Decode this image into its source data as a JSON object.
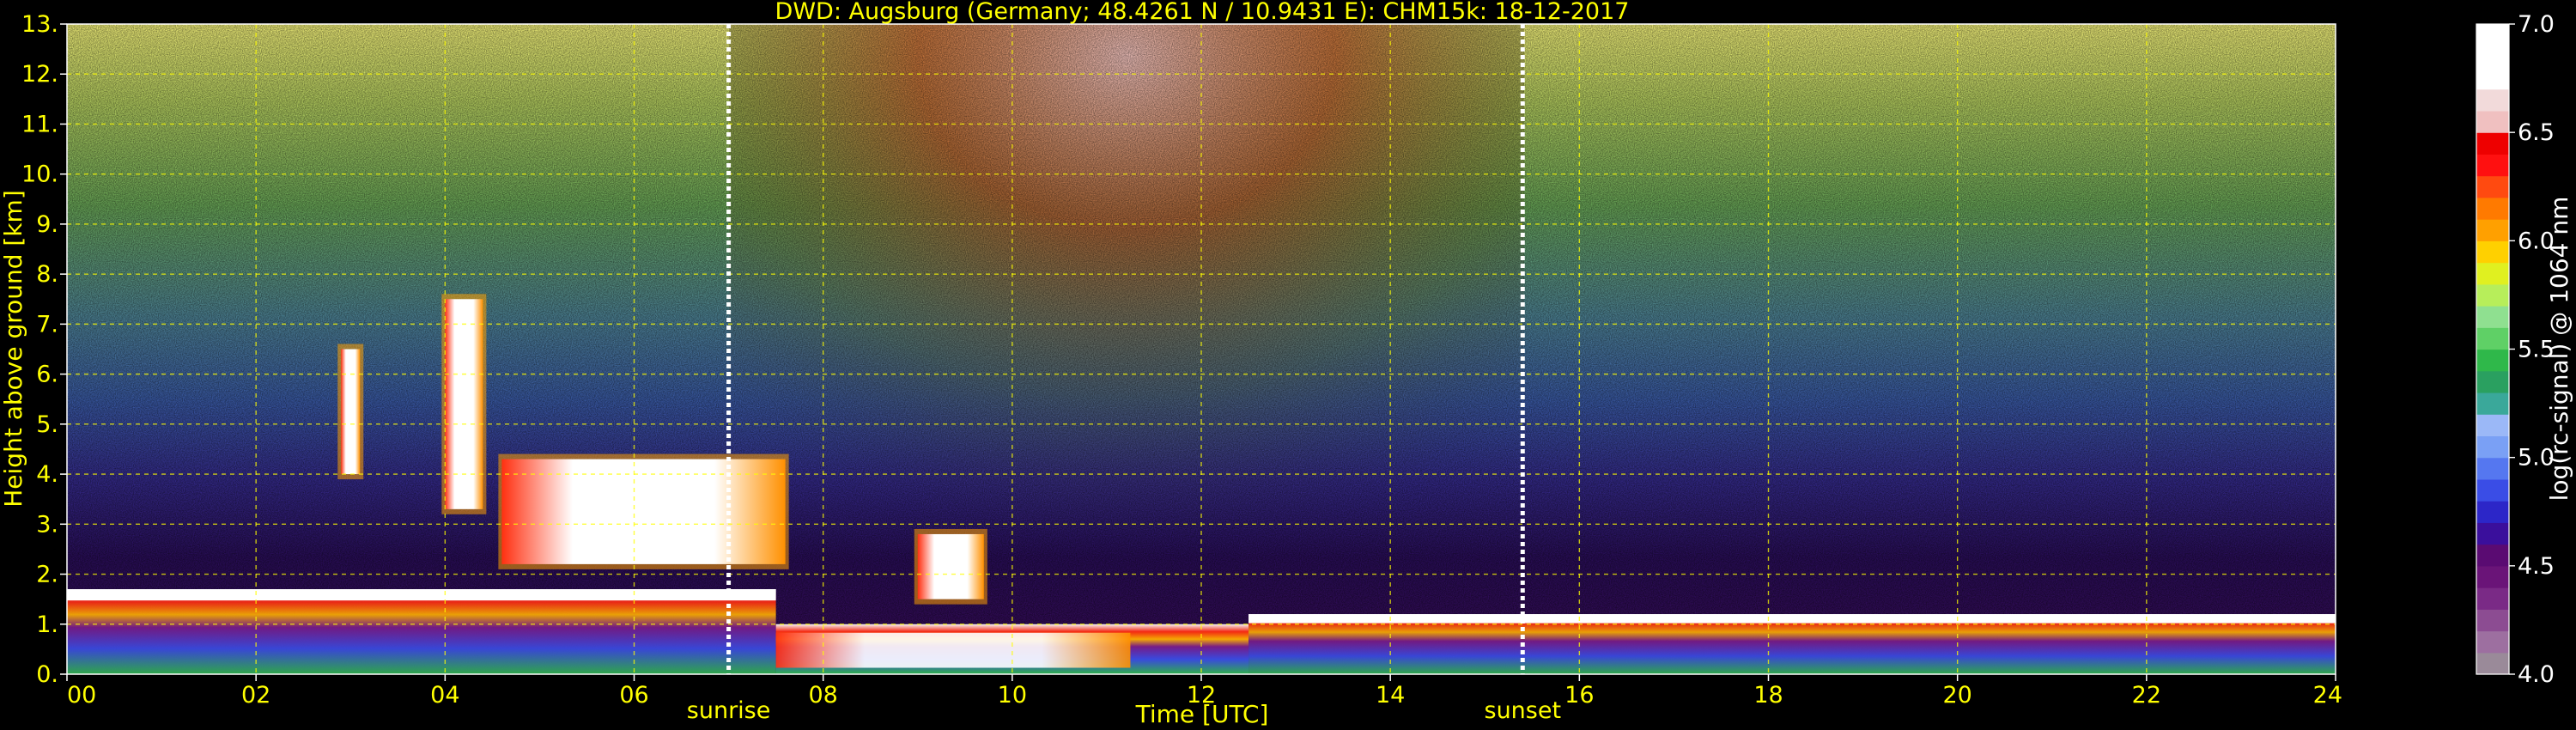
{
  "chart_data": {
    "type": "heatmap",
    "title": "DWD: Augsburg (Germany; 48.4261 N / 10.9431 E):    CHM15k: 18-12-2017",
    "xlabel": "Time [UTC]",
    "ylabel": "Height above ground [km]",
    "x_ticks": [
      "00",
      "02",
      "04",
      "06",
      "08",
      "10",
      "12",
      "14",
      "16",
      "18",
      "20",
      "22",
      "24"
    ],
    "y_ticks": [
      "0.",
      "1.",
      "2.",
      "3.",
      "4.",
      "5.",
      "6.",
      "7.",
      "8.",
      "9.",
      "10.",
      "11.",
      "12.",
      "13."
    ],
    "xlim": [
      0,
      24
    ],
    "ylim": [
      0,
      13
    ],
    "grid": true,
    "markers": [
      {
        "label": "sunrise",
        "time": 7.0
      },
      {
        "label": "sunset",
        "time": 15.4
      }
    ],
    "colorbar": {
      "label": "log(rc-signal) @ 1064 nm",
      "range": [
        4.0,
        7.0
      ],
      "ticks": [
        "4.0",
        "4.5",
        "5.0",
        "5.5",
        "6.0",
        "6.5",
        "7.0"
      ],
      "colors": [
        "#9a8a99",
        "#9d6fa0",
        "#8c4c92",
        "#7a2a86",
        "#6a1478",
        "#5a0b72",
        "#3a0f9c",
        "#2c26c8",
        "#3a4de6",
        "#5577f0",
        "#7aa0f5",
        "#9bb8f7",
        "#3aa89a",
        "#2aa060",
        "#2fb84a",
        "#5fd066",
        "#8fe090",
        "#b7ee5a",
        "#e0f020",
        "#ffd000",
        "#ffa000",
        "#ff7a00",
        "#ff4a10",
        "#ff1010",
        "#ee0000",
        "#f0c0c0",
        "#f2dada",
        "#ffffff",
        "#ffffff",
        "#ffffff"
      ]
    },
    "features": [
      {
        "type": "boundary_layer",
        "time_start": 0,
        "time_end": 7.5,
        "height_km": [
          1.2,
          1.7
        ]
      },
      {
        "type": "cloud",
        "time_start": 2.9,
        "time_end": 3.1,
        "height_km": [
          4.0,
          6.5
        ]
      },
      {
        "type": "cloud",
        "time_start": 4.0,
        "time_end": 4.4,
        "height_km": [
          3.3,
          7.5
        ]
      },
      {
        "type": "cloud",
        "time_start": 4.6,
        "time_end": 7.6,
        "height_km": [
          2.2,
          4.3
        ]
      },
      {
        "type": "cloud",
        "time_start": 9.0,
        "time_end": 9.7,
        "height_km": [
          1.5,
          2.8
        ]
      },
      {
        "type": "low_cloud",
        "time_start": 7.5,
        "time_end": 12.5,
        "height_km": [
          0.0,
          1.0
        ]
      },
      {
        "type": "boundary_layer",
        "time_start": 12.5,
        "time_end": 24,
        "height_km": [
          0.8,
          1.2
        ]
      }
    ]
  }
}
